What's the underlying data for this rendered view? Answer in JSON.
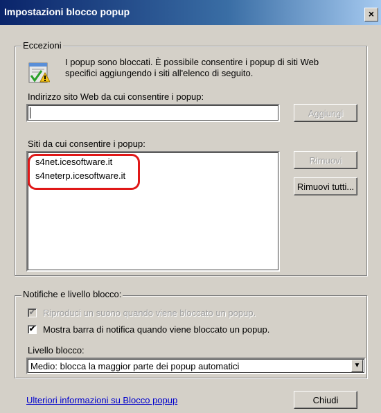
{
  "window": {
    "title": "Impostazioni blocco popup",
    "close_glyph": "×"
  },
  "exceptions": {
    "legend": "Eccezioni",
    "info_line1": "I popup sono bloccati. È possibile consentire i popup di siti Web",
    "info_line2": "specifici aggiungendo i siti all'elenco di seguito.",
    "info_icon": "popup-blocker-info-icon",
    "address_label": "Indirizzo sito Web da cui consentire i popup:",
    "address_value": "",
    "add_button": "Aggiungi",
    "sites_label": "Siti da cui consentire i popup:",
    "sites": [
      "s4net.icesoftware.it",
      "s4neterp.icesoftware.it"
    ],
    "remove_button": "Rimuovi",
    "remove_all_button": "Rimuovi tutti..."
  },
  "notifications": {
    "legend": "Notifiche e livello blocco:",
    "sound_label": "Riproduci un suono quando viene bloccato un popup.",
    "sound_checked": true,
    "sound_enabled": false,
    "bar_label": "Mostra barra di notifica quando viene bloccato un popup.",
    "bar_checked": true,
    "level_label": "Livello blocco:",
    "level_value": "Medio: blocca la maggior parte dei popup automatici"
  },
  "footer": {
    "more_info_link": "Ulteriori informazioni su Blocco popup",
    "close_button": "Chiudi"
  },
  "colors": {
    "highlight": "#e01818",
    "link": "#0000cc",
    "titlebar_start": "#0a246a"
  }
}
